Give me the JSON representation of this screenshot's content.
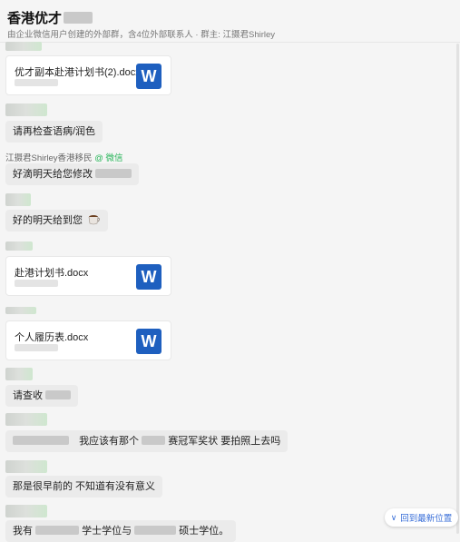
{
  "header": {
    "title": "香港优才",
    "subtitle": "由企业微信用户创建的外部群，含4位外部联系人 · 群主: 江摄君Shirley"
  },
  "messages": {
    "file1": {
      "name": "优才副本赴港计划书(2).docx",
      "icon": "W"
    },
    "text1": "请再检查语病/润色",
    "sender": {
      "name": "江摄君Shirley香港移民",
      "tag": "@ 微信"
    },
    "text2": "好滴明天给您修改",
    "text3": "好的明天给到您",
    "file2": {
      "name": "赴港计划书.docx",
      "icon": "W"
    },
    "file3": {
      "name": "个人履历表.docx",
      "icon": "W"
    },
    "text4": "请查收",
    "text5a": "我应该有那个",
    "text5b": "赛冠军奖状 要拍照上去吗",
    "text6": "那是很早前的 不知道有没有意义",
    "text7a": "我有",
    "text7b": "学士学位与",
    "text7c": "硕士学位。"
  },
  "scroll_button": {
    "label": "回到最新位置",
    "icon": "double-chevron-down-icon"
  },
  "colors": {
    "accent": "#3a6fd8",
    "word": "#1e5fbf",
    "wechat": "#29b55a"
  }
}
